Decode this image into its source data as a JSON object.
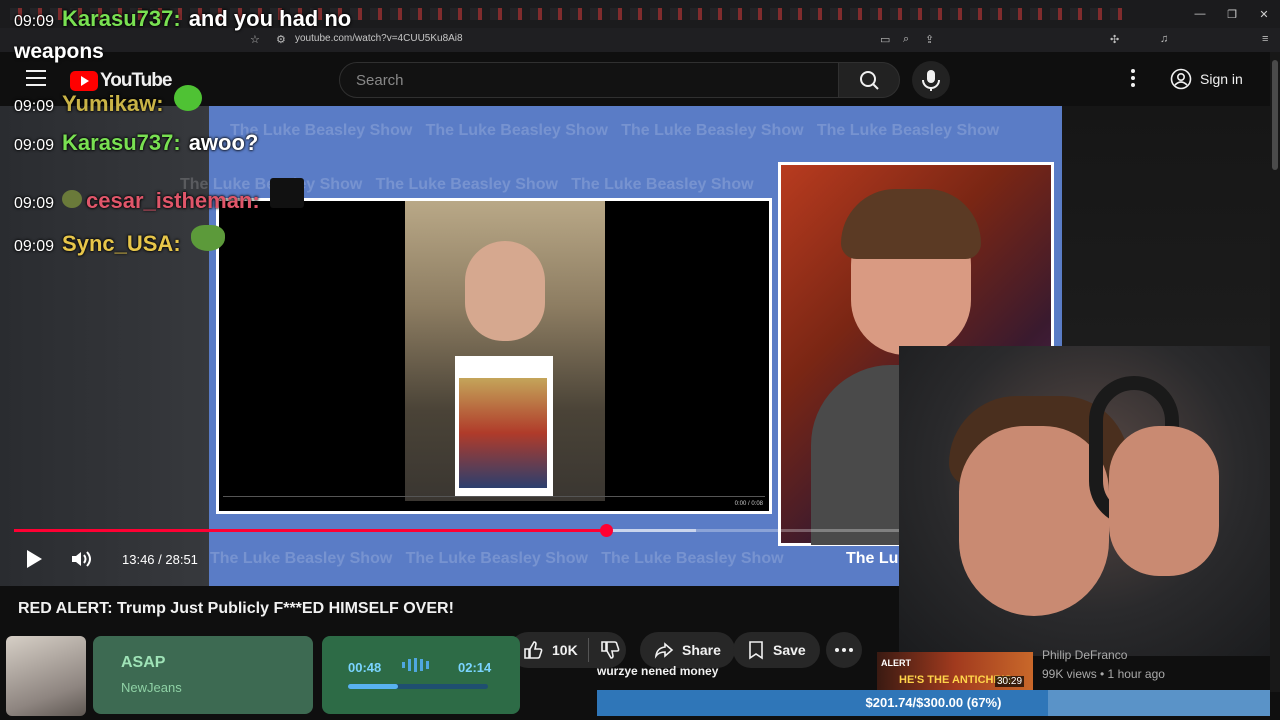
{
  "browser": {
    "url": "youtube.com/watch?v=4CUU5Ku8Ai8",
    "window_controls": [
      "—",
      "❐",
      "✕"
    ]
  },
  "header": {
    "logo_text": "YouTube",
    "search_placeholder": "Search",
    "sign_in_label": "Sign in"
  },
  "chat": {
    "lines": [
      {
        "time": "09:09",
        "user": "Karasu737:",
        "user_color": "#79e052",
        "message": "and you had no"
      },
      {
        "time": "09:09",
        "user": "Yumikaw:",
        "user_color": "#c9b347",
        "message": ""
      },
      {
        "time": "09:09",
        "user": "Karasu737:",
        "user_color": "#79e052",
        "message": "awoo?"
      },
      {
        "time": "09:09",
        "user": "cesar_istheman:",
        "user_color": "#e0566a",
        "message": ""
      },
      {
        "time": "09:09",
        "user": "Sync_USA:",
        "user_color": "#e7c64a",
        "message": ""
      }
    ],
    "wrap_text": "weapons"
  },
  "player": {
    "watermark": "The Luke Beasley Show",
    "show_name": "The Lu",
    "inner_time": "0:00 / 0:08",
    "time_display": "13:46 / 28:51",
    "progress": 0.573,
    "buffered": 0.66
  },
  "video": {
    "title": "RED ALERT: Trump Just Publicly F***ED HIMSELF OVER!",
    "like_count": "10K",
    "share_label": "Share",
    "save_label": "Save"
  },
  "music": {
    "title": "ASAP",
    "artist": "NewJeans",
    "current": "00:48",
    "total": "02:14",
    "progress": 0.36
  },
  "ticker_text": "wurzye nened money",
  "recommended": {
    "thumb_label": "ALERT",
    "thumb_caption": "HE'S THE ANTICHRIS",
    "duration": "30:29",
    "channel": "Philip DeFranco",
    "meta": "99K views • 1 hour ago"
  },
  "goal": {
    "text": "$201.74/$300.00 (67%)",
    "fraction": 0.67
  },
  "colors": {
    "accent_red": "#ff0033",
    "player_bg": "#5a7cc6",
    "music_card": "#3d6a52",
    "goal_bar": "#2f76b8"
  }
}
